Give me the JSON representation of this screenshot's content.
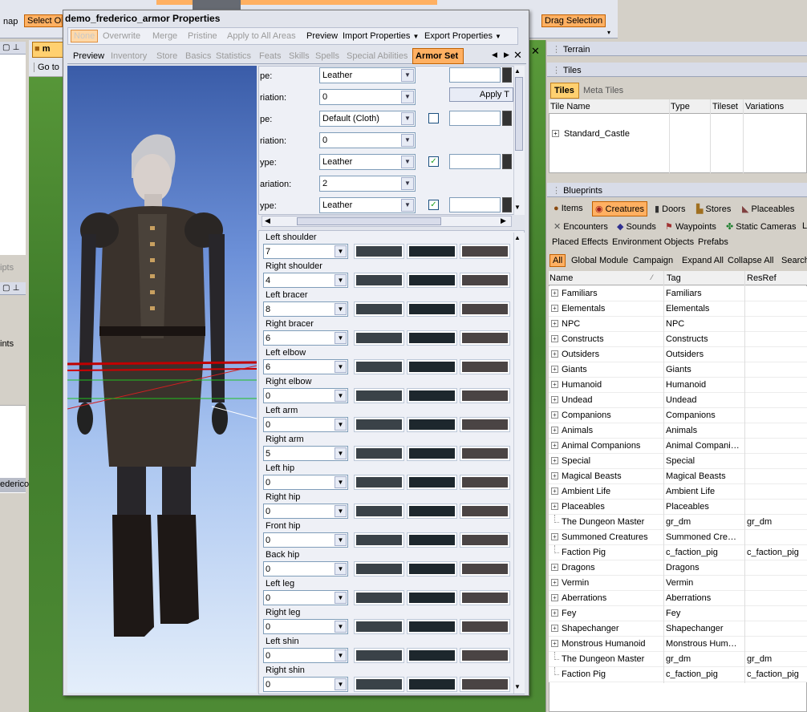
{
  "toolbar": {
    "nap": "nap",
    "select_obj": "Select Ob",
    "drag_selection": "Drag Selection"
  },
  "left_strip": {
    "ipts": "ipts",
    "ints": "ints",
    "ederico": "ederico"
  },
  "viewport_tab": {
    "label": "m",
    "goto": "Go to"
  },
  "dialog": {
    "title": "demo_frederico_armor Properties",
    "menu": [
      "None",
      "Overwrite",
      "Merge",
      "Pristine",
      "Apply to All Areas",
      "Preview",
      "Import Properties",
      "Export Properties"
    ],
    "tabs": [
      "Preview",
      "Inventory",
      "Store",
      "Basics",
      "Statistics",
      "Feats",
      "Skills",
      "Spells",
      "Special Abilities",
      "Armor Set"
    ],
    "active_tab": "Armor Set",
    "apply_label": "Apply T",
    "top_rows": [
      {
        "label": "pe:",
        "value": "Leather",
        "checkbox": null
      },
      {
        "label": "riation:",
        "value": "0",
        "checkbox": null
      },
      {
        "label": "pe:",
        "value": "Default (Cloth)",
        "checkbox": "unchecked"
      },
      {
        "label": "riation:",
        "value": "0",
        "checkbox": null
      },
      {
        "label": "ype:",
        "value": "Leather",
        "checkbox": "checked"
      },
      {
        "label": "ariation:",
        "value": "2",
        "checkbox": null
      },
      {
        "label": "ype:",
        "value": "Leather",
        "checkbox": "checked"
      }
    ],
    "pieces": [
      {
        "label": "Left shoulder",
        "value": "7"
      },
      {
        "label": "Right shoulder",
        "value": "4"
      },
      {
        "label": "Left bracer",
        "value": "8"
      },
      {
        "label": "Right bracer",
        "value": "6"
      },
      {
        "label": "Left elbow",
        "value": "6"
      },
      {
        "label": "Right elbow",
        "value": "0"
      },
      {
        "label": "Left arm",
        "value": "0"
      },
      {
        "label": "Right arm",
        "value": "5"
      },
      {
        "label": "Left hip",
        "value": "0"
      },
      {
        "label": "Right hip",
        "value": "0"
      },
      {
        "label": "Front hip",
        "value": "0"
      },
      {
        "label": "Back hip",
        "value": "0"
      },
      {
        "label": "Left leg",
        "value": "0"
      },
      {
        "label": "Right leg",
        "value": "0"
      },
      {
        "label": "Left shin",
        "value": "0"
      },
      {
        "label": "Right shin",
        "value": "0"
      }
    ],
    "swatch_colors": [
      "#3a4248",
      "#1d272d",
      "#4a4444"
    ]
  },
  "terrain": {
    "title": "Terrain"
  },
  "tiles": {
    "title": "Tiles",
    "tabs": [
      "Tiles",
      "Meta Tiles"
    ],
    "columns": [
      "Tile Name",
      "Type",
      "Tileset",
      "Variations"
    ],
    "rows": [
      "Standard_Castle"
    ]
  },
  "blueprints": {
    "title": "Blueprints",
    "categories_row1": [
      "Items",
      "Creatures",
      "Doors",
      "Stores",
      "Placeables"
    ],
    "categories_row2": [
      "Encounters",
      "Sounds",
      "Waypoints",
      "Static Cameras",
      "L"
    ],
    "categories_row3": [
      "Placed Effects",
      "Environment Objects",
      "Prefabs"
    ],
    "active_category": "Creatures",
    "filters": [
      "All",
      "Global",
      "Module",
      "Campaign",
      "Expand All",
      "Collapse All",
      "Search"
    ],
    "columns": [
      "Name",
      "Tag",
      "ResRef"
    ],
    "rows": [
      {
        "name": "Familiars",
        "tag": "Familiars",
        "resref": "",
        "expand": true
      },
      {
        "name": "Elementals",
        "tag": "Elementals",
        "resref": "",
        "expand": true
      },
      {
        "name": "NPC",
        "tag": "NPC",
        "resref": "",
        "expand": true
      },
      {
        "name": "Constructs",
        "tag": "Constructs",
        "resref": "",
        "expand": true
      },
      {
        "name": "Outsiders",
        "tag": "Outsiders",
        "resref": "",
        "expand": true
      },
      {
        "name": "Giants",
        "tag": "Giants",
        "resref": "",
        "expand": true
      },
      {
        "name": "Humanoid",
        "tag": "Humanoid",
        "resref": "",
        "expand": true
      },
      {
        "name": "Undead",
        "tag": "Undead",
        "resref": "",
        "expand": true
      },
      {
        "name": "Companions",
        "tag": "Companions",
        "resref": "",
        "expand": true
      },
      {
        "name": "Animals",
        "tag": "Animals",
        "resref": "",
        "expand": true
      },
      {
        "name": "Animal Companions",
        "tag": "Animal Compani…",
        "resref": "",
        "expand": true
      },
      {
        "name": "Special",
        "tag": "Special",
        "resref": "",
        "expand": true
      },
      {
        "name": "Magical Beasts",
        "tag": "Magical Beasts",
        "resref": "",
        "expand": true
      },
      {
        "name": "Ambient Life",
        "tag": "Ambient Life",
        "resref": "",
        "expand": true
      },
      {
        "name": "Placeables",
        "tag": "Placeables",
        "resref": "",
        "expand": true
      },
      {
        "name": "The Dungeon Master",
        "tag": "gr_dm",
        "resref": "gr_dm",
        "expand": false
      },
      {
        "name": "Summoned Creatures",
        "tag": "Summoned Cre…",
        "resref": "",
        "expand": true
      },
      {
        "name": "Faction Pig",
        "tag": "c_faction_pig",
        "resref": "c_faction_pig",
        "expand": false
      },
      {
        "name": "Dragons",
        "tag": "Dragons",
        "resref": "",
        "expand": true
      },
      {
        "name": "Vermin",
        "tag": "Vermin",
        "resref": "",
        "expand": true
      },
      {
        "name": "Aberrations",
        "tag": "Aberrations",
        "resref": "",
        "expand": true
      },
      {
        "name": "Fey",
        "tag": "Fey",
        "resref": "",
        "expand": true
      },
      {
        "name": "Shapechanger",
        "tag": "Shapechanger",
        "resref": "",
        "expand": true
      },
      {
        "name": "Monstrous Humanoid",
        "tag": "Monstrous Hum…",
        "resref": "",
        "expand": true
      },
      {
        "name": "The Dungeon Master",
        "tag": "gr_dm",
        "resref": "gr_dm",
        "expand": false
      },
      {
        "name": "Faction Pig",
        "tag": "c_faction_pig",
        "resref": "c_faction_pig",
        "expand": false
      }
    ]
  }
}
